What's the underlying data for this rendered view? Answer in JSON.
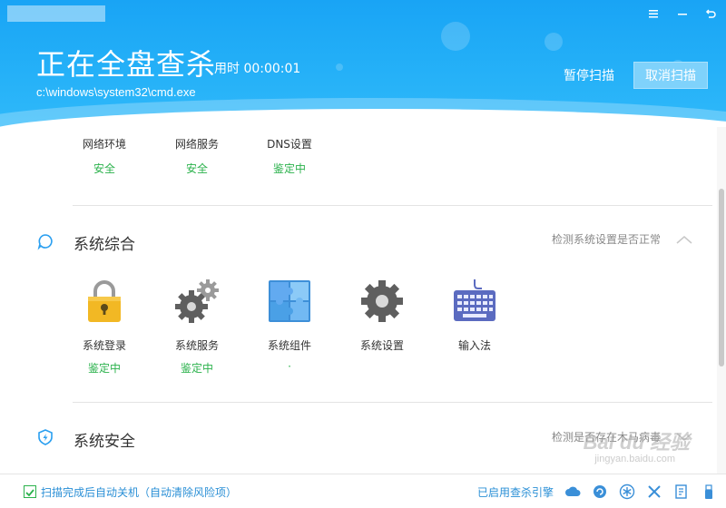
{
  "header": {
    "title": "正在全盘查杀",
    "elapsed": "用时 00:00:01",
    "current_file": "c:\\windows\\system32\\cmd.exe",
    "pause_label": "暂停扫描",
    "cancel_label": "取消扫描",
    "window_controls": [
      "menu-icon",
      "minimize-icon",
      "restore-icon",
      "back-icon"
    ]
  },
  "network": {
    "items": [
      {
        "label": "网络环境",
        "status": "安全"
      },
      {
        "label": "网络服务",
        "status": "安全"
      },
      {
        "label": "DNS设置",
        "status": "鉴定中"
      }
    ]
  },
  "system_general": {
    "title": "系统综合",
    "description": "检测系统设置是否正常",
    "items": [
      {
        "label": "系统登录",
        "status": "鉴定中",
        "icon": "padlock-icon"
      },
      {
        "label": "系统服务",
        "status": "鉴定中",
        "icon": "gears-icon"
      },
      {
        "label": "系统组件",
        "status": "·",
        "icon": "puzzle-icon"
      },
      {
        "label": "系统设置",
        "status": "",
        "icon": "gear-icon"
      },
      {
        "label": "输入法",
        "status": "",
        "icon": "keyboard-icon"
      }
    ]
  },
  "system_security": {
    "title": "系统安全",
    "description": "检测是否存在木马病毒"
  },
  "footer": {
    "auto_shutdown": "扫描完成后自动关机（自动清除风险项）",
    "engine": "已启用查杀引擎",
    "icons": [
      "cloud-engine-icon",
      "refresh-engine-icon",
      "snowflake-engine-icon",
      "tools-engine-icon",
      "doc-engine-icon",
      "usb-engine-icon"
    ]
  },
  "watermark": {
    "brand": "Bai du 经验",
    "url": "jingyan.baidu.com"
  },
  "colors": {
    "header_blue": "#22aef7",
    "status_green": "#2bb24c",
    "link_blue": "#2a8fd6"
  }
}
